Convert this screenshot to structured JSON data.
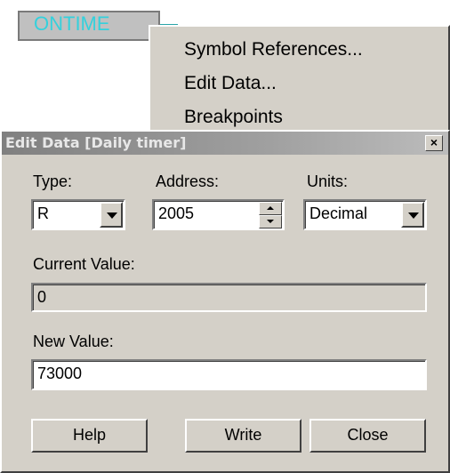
{
  "ladder": {
    "element_label": "ONTIME",
    "accent_color": "#34d1dc"
  },
  "context_menu": {
    "items": [
      {
        "label": "Symbol References..."
      },
      {
        "label": "Edit Data..."
      },
      {
        "label": "Breakpoints"
      }
    ]
  },
  "dialog": {
    "title": "Edit Data [Daily timer]",
    "close_icon": "close-icon",
    "type": {
      "label": "Type:",
      "value": "R"
    },
    "address": {
      "label": "Address:",
      "value": "2005"
    },
    "units": {
      "label": "Units:",
      "value": "Decimal"
    },
    "current_value": {
      "label": "Current Value:",
      "value": "0"
    },
    "new_value": {
      "label": "New Value:",
      "value": "73000"
    },
    "buttons": {
      "help": "Help",
      "write": "Write",
      "close": "Close"
    }
  }
}
